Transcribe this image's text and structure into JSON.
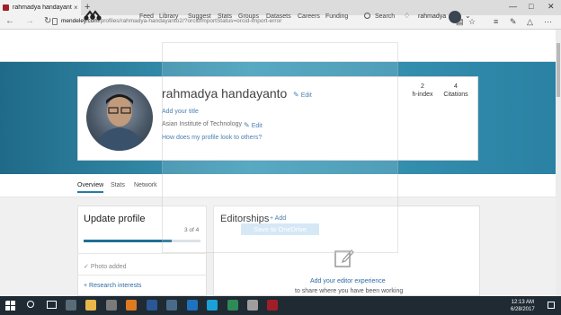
{
  "browser": {
    "tab_title": "rahmadya handayanto -",
    "tab_close": "×",
    "new_tab": "+",
    "url_domain": "mendeley.com",
    "url_path": "/profiles/rahmadya-handayanto2/?orcidImportStatus=orcid-import-error",
    "icons": [
      "back-icon",
      "forward-icon",
      "refresh-icon",
      "reading-view-icon",
      "favorite-icon",
      "hub-icon",
      "notes-icon",
      "share-icon",
      "more-icon"
    ]
  },
  "header": {
    "nav": [
      "Feed",
      "Library",
      "Suggest",
      "Stats",
      "Groups",
      "Datasets",
      "Careers",
      "Funding"
    ],
    "search_label": "Search",
    "username": "rahmadya"
  },
  "profile": {
    "name": "rahmadya handayanto",
    "edit": "Edit",
    "add_title": "Add your title",
    "institution": "Asian Institute of Technology",
    "how_look": "How does my profile look to others?",
    "stats": [
      {
        "value": "2",
        "label": "h-index"
      },
      {
        "value": "4",
        "label": "Citations"
      }
    ]
  },
  "tabs": [
    "Overview",
    "Stats",
    "Network"
  ],
  "update_profile": {
    "title": "Update profile",
    "count": "3 of 4",
    "progress_fraction": 0.75,
    "photo_added": "Photo added",
    "research_interests": "Research interests"
  },
  "editorships": {
    "title": "Editorships",
    "add": "Add",
    "link": "Add your editor experience",
    "sub": "to share where you have been working"
  },
  "overlay": {
    "button": "Save to OneDrive"
  },
  "taskbar": {
    "time": "12:13 AM",
    "date": "6/28/2017"
  }
}
